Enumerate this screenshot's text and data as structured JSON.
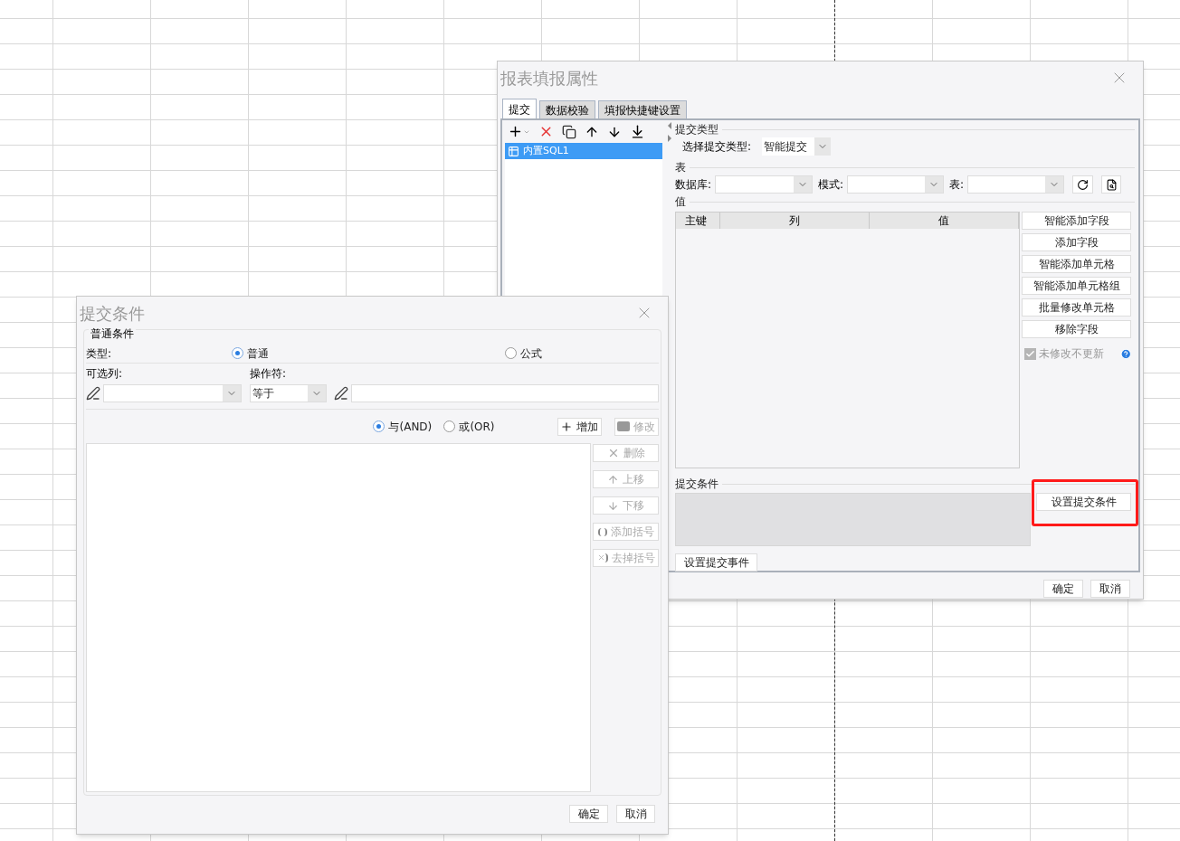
{
  "report_dialog": {
    "title": "报表填报属性",
    "tabs": [
      {
        "label": "提交",
        "selected": true
      },
      {
        "label": "数据校验",
        "selected": false
      },
      {
        "label": "填报快捷键设置",
        "selected": false
      }
    ],
    "list_items": [
      {
        "label": "内置SQL1",
        "selected": true
      }
    ],
    "submit_type": {
      "section": "提交类型",
      "label": "选择提交类型:",
      "value": "智能提交"
    },
    "table_section": {
      "section": "表",
      "database_label": "数据库:",
      "schema_label": "模式:",
      "table_label": "表:"
    },
    "value_section": {
      "section": "值",
      "columns": [
        "主键",
        "列",
        "值"
      ],
      "buttons": [
        "智能添加字段",
        "添加字段",
        "智能添加单元格",
        "智能添加单元格组",
        "批量修改单元格",
        "移除字段"
      ],
      "checkbox": {
        "label": "未修改不更新",
        "checked": true,
        "disabled": true
      }
    },
    "condition_section": {
      "section": "提交条件",
      "button": {
        "label": "设置提交条件",
        "highlighted": true
      }
    },
    "event_button": "设置提交事件",
    "footer_buttons": [
      "确定",
      "取消"
    ]
  },
  "condition_dialog": {
    "title": "提交条件",
    "section": "普通条件",
    "type_label": "类型:",
    "type_options": [
      {
        "label": "普通",
        "selected": true
      },
      {
        "label": "公式",
        "selected": false
      }
    ],
    "column_label": "可选列:",
    "operator_label": "操作符:",
    "operator_value": "等于",
    "logic_options": [
      {
        "label": "与(AND)",
        "selected": true
      },
      {
        "label": "或(OR)",
        "selected": false
      }
    ],
    "add_button": {
      "label": "增加",
      "disabled": false
    },
    "edit_button": {
      "label": "修改",
      "disabled": true
    },
    "side_buttons": [
      {
        "kind": "delete",
        "label": "删除",
        "disabled": true
      },
      {
        "kind": "up",
        "label": "上移",
        "disabled": true
      },
      {
        "kind": "down",
        "label": "下移",
        "disabled": true
      },
      {
        "kind": "add_bracket",
        "label": "添加括号",
        "disabled": true
      },
      {
        "kind": "remove_bracket",
        "label": "去掉括号",
        "disabled": true
      }
    ],
    "footer_buttons": [
      "确定",
      "取消"
    ]
  }
}
